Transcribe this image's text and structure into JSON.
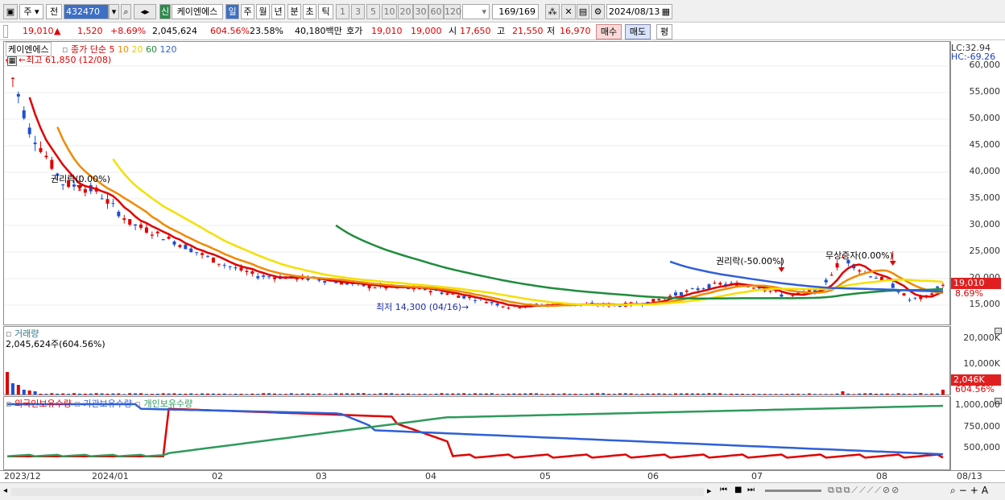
{
  "toolbar": {
    "mode1": "주",
    "mode2": "전",
    "code": "432470",
    "tag": "신",
    "name": "케이엔에스",
    "periods": [
      "일",
      "주",
      "월",
      "년",
      "분",
      "초",
      "틱"
    ],
    "nums": [
      "1",
      "3",
      "5",
      "10",
      "20",
      "30",
      "60",
      "120"
    ],
    "count": "169/169",
    "date": "2024/08/13"
  },
  "info": {
    "price": "19,010",
    "arrow": "▲",
    "change": "1,520",
    "rate": "+8.69%",
    "volume": "2,045,624",
    "vol_rate": "604.56%",
    "turnover": "23.58%",
    "amount": "40,180백만",
    "bid_label": "호가",
    "bid": "19,010",
    "ask": "19,000",
    "open_label": "시",
    "open": "17,650",
    "high_label": "고",
    "high": "21,550",
    "low_label": "저",
    "low": "16,970",
    "buy": "매수",
    "sell": "매도",
    "avg": "평"
  },
  "price_panel": {
    "name": "케이엔에스",
    "ma_label": "종가 단순",
    "ma_periods": [
      "5",
      "10",
      "20",
      "60",
      "120"
    ],
    "ma_colors": [
      "#e00000",
      "#f08a00",
      "#f4e000",
      "#1f8c3c",
      "#2f5fd8"
    ],
    "high_note": "←최고 61,850 (12/08)",
    "low_note": "최저 14,300 (04/16)→",
    "ann1": "권리락(0.00%)",
    "ann2": "권리락(-50.00%)",
    "ann3": "무상증자(0.00%)",
    "lc": "LC:32.94",
    "hc": "HC:-69.26",
    "yticks": [
      "60,000",
      "55,000",
      "50,000",
      "45,000",
      "40,000",
      "35,000",
      "30,000",
      "25,000",
      "20,000",
      "15,000"
    ],
    "cur_price": "19,010",
    "cur_rate": "8.69%"
  },
  "volume_panel": {
    "title": "거래량",
    "note": "2,045,624주(604.56%)",
    "yticks": [
      "20,000K",
      "10,000K"
    ],
    "badge": "2,046K",
    "badge_rate": "604.56%"
  },
  "holding_panel": {
    "legend": [
      "외국인보유수량",
      "기관보유수량",
      "개인보유수량"
    ],
    "colors": [
      "#e00000",
      "#2f5fd8",
      "#2f9a5c"
    ],
    "yticks": [
      "1,000,000",
      "750,000",
      "500,000"
    ]
  },
  "xaxis": [
    "2023/12",
    "2024/01",
    "02",
    "03",
    "04",
    "05",
    "06",
    "07",
    "08"
  ],
  "x_end": "08/13"
}
